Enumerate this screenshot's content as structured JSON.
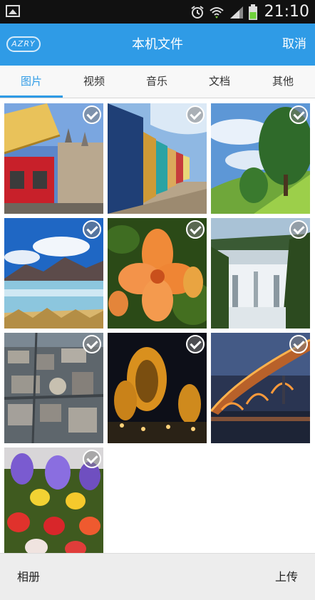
{
  "status_bar": {
    "time": "21:10",
    "icons": [
      "image-icon",
      "alarm-icon",
      "wifi-icon",
      "signal-icon",
      "battery-icon"
    ]
  },
  "header": {
    "logo_text": "AZRY",
    "title": "本机文件",
    "cancel_label": "取消",
    "color": "#2f9be6"
  },
  "tabs": [
    {
      "label": "图片",
      "active": true
    },
    {
      "label": "视频",
      "active": false
    },
    {
      "label": "音乐",
      "active": false
    },
    {
      "label": "文档",
      "active": false
    },
    {
      "label": "其他",
      "active": false
    }
  ],
  "photos": [
    {
      "subject": "umbrella-street"
    },
    {
      "subject": "beach-huts"
    },
    {
      "subject": "green-hill"
    },
    {
      "subject": "mountain-lake"
    },
    {
      "subject": "orange-flower"
    },
    {
      "subject": "waterfall"
    },
    {
      "subject": "city-aerial"
    },
    {
      "subject": "night-domes"
    },
    {
      "subject": "night-bridge"
    },
    {
      "subject": "flower-garden"
    }
  ],
  "bottom_bar": {
    "album_label": "相册",
    "upload_label": "上传"
  }
}
